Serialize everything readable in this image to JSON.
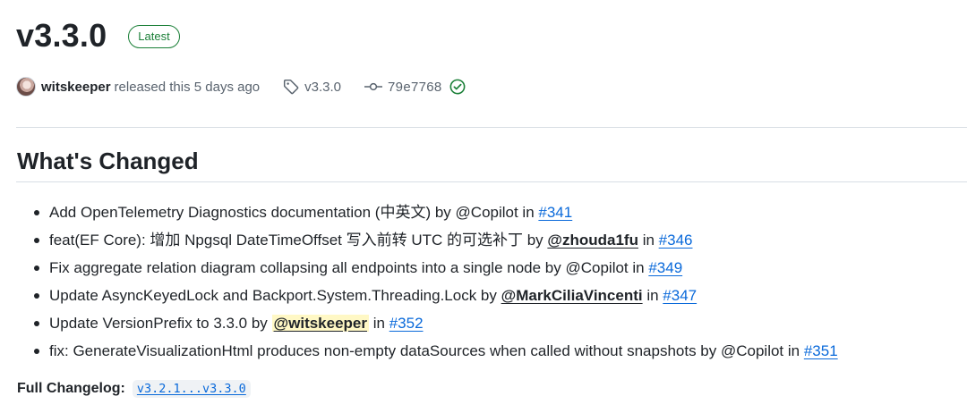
{
  "release": {
    "title": "v3.3.0",
    "badge": "Latest"
  },
  "meta": {
    "author": "witskeeper",
    "released_text": "released this 5 days ago",
    "tag": "v3.3.0",
    "commit": "79e7768",
    "icons": {
      "tag": "tag-icon",
      "commit": "git-commit-icon",
      "verified": "check-circle-icon"
    }
  },
  "section": {
    "heading": "What's Changed"
  },
  "changes": [
    {
      "pre": "Add OpenTelemetry Diagnostics documentation (中英文) by @Copilot in ",
      "pr": "#341"
    },
    {
      "pre": "feat(EF Core): 增加 Npgsql DateTimeOffset 写入前转 UTC 的可选补丁 by ",
      "mention": "@zhouda1fu",
      "mid": " in ",
      "pr": "#346"
    },
    {
      "pre": "Fix aggregate relation diagram collapsing all endpoints into a single node by @Copilot in ",
      "pr": "#349"
    },
    {
      "pre": "Update AsyncKeyedLock and Backport.System.Threading.Lock by ",
      "mention": "@MarkCiliaVincenti",
      "mid": " in ",
      "pr": "#347"
    },
    {
      "pre": "Update VersionPrefix to 3.3.0 by ",
      "mention": "@witskeeper",
      "mid": " in ",
      "pr": "#352"
    },
    {
      "pre": "fix: GenerateVisualizationHtml produces non-empty dataSources when called without snapshots by @Copilot in ",
      "pr": "#351"
    }
  ],
  "changelog": {
    "label": "Full Changelog:",
    "range": "v3.2.1...v3.3.0"
  },
  "colors": {
    "link": "#0969da",
    "latest_badge": "#1a7f37",
    "mention_highlight": "#fff8c5"
  }
}
